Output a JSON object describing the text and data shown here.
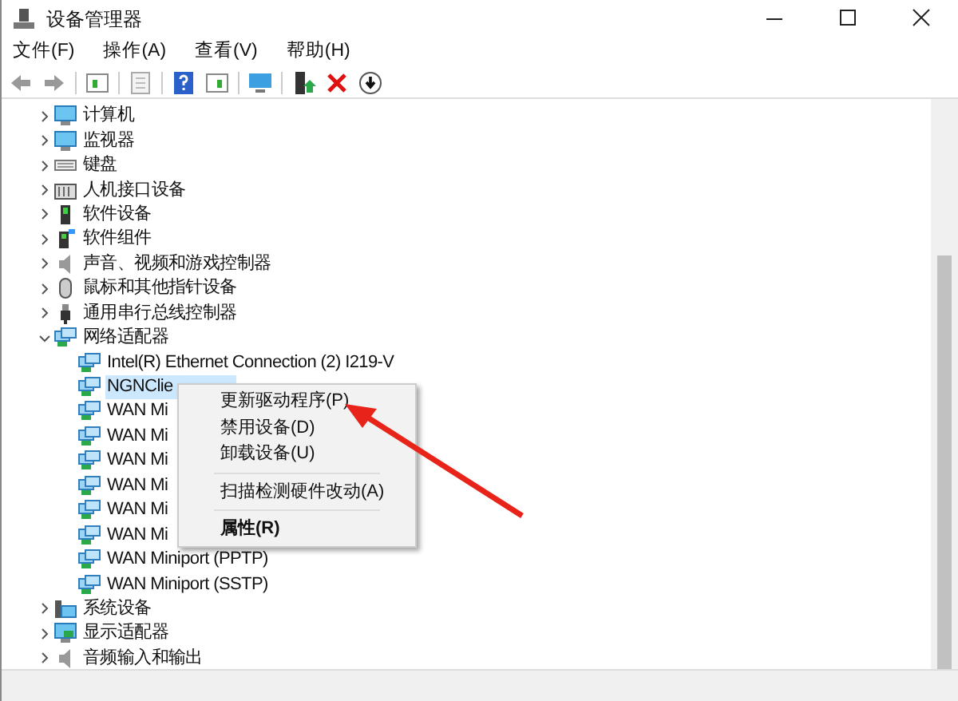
{
  "window": {
    "title": "设备管理器"
  },
  "menu": [
    "文件(F)",
    "操作(A)",
    "查看(V)",
    "帮助(H)"
  ],
  "tree": [
    {
      "label": "计算机",
      "expanded": false,
      "selected": false
    },
    {
      "label": "监视器",
      "expanded": false,
      "selected": false
    },
    {
      "label": "键盘",
      "expanded": false,
      "selected": false
    },
    {
      "label": "人机接口设备",
      "expanded": false,
      "selected": false
    },
    {
      "label": "软件设备",
      "expanded": false,
      "selected": false
    },
    {
      "label": "软件组件",
      "expanded": false,
      "selected": false
    },
    {
      "label": "声音、视频和游戏控制器",
      "expanded": false,
      "selected": false
    },
    {
      "label": "鼠标和其他指针设备",
      "expanded": false,
      "selected": false
    },
    {
      "label": "通用串行总线控制器",
      "expanded": false,
      "selected": false
    },
    {
      "label": "网络适配器",
      "expanded": true,
      "selected": false,
      "children": [
        {
          "label": "Intel(R) Ethernet Connection (2) I219-V",
          "selected": false
        },
        {
          "label": "NGNClie",
          "selected": true
        },
        {
          "label": "WAN Mi",
          "selected": false
        },
        {
          "label": "WAN Mi",
          "selected": false
        },
        {
          "label": "WAN Mi",
          "selected": false
        },
        {
          "label": "WAN Mi",
          "selected": false
        },
        {
          "label": "WAN Mi",
          "selected": false
        },
        {
          "label": "WAN Mi",
          "selected": false
        },
        {
          "label": "WAN Miniport (PPTP)",
          "selected": false
        },
        {
          "label": "WAN Miniport (SSTP)",
          "selected": false
        }
      ]
    },
    {
      "label": "系统设备",
      "expanded": false,
      "selected": false
    },
    {
      "label": "显示适配器",
      "expanded": false,
      "selected": false
    },
    {
      "label": "音频输入和输出",
      "expanded": false,
      "selected": false
    }
  ],
  "context_menu": [
    {
      "label": "更新驱动程序(P)",
      "default": false,
      "separator_before": false
    },
    {
      "label": "禁用设备(D)",
      "default": false,
      "separator_before": false
    },
    {
      "label": "卸载设备(U)",
      "default": false,
      "separator_before": false
    },
    {
      "label": "扫描检测硬件改动(A)",
      "default": false,
      "separator_before": true
    },
    {
      "label": "属性(R)",
      "default": true,
      "separator_before": true
    }
  ]
}
